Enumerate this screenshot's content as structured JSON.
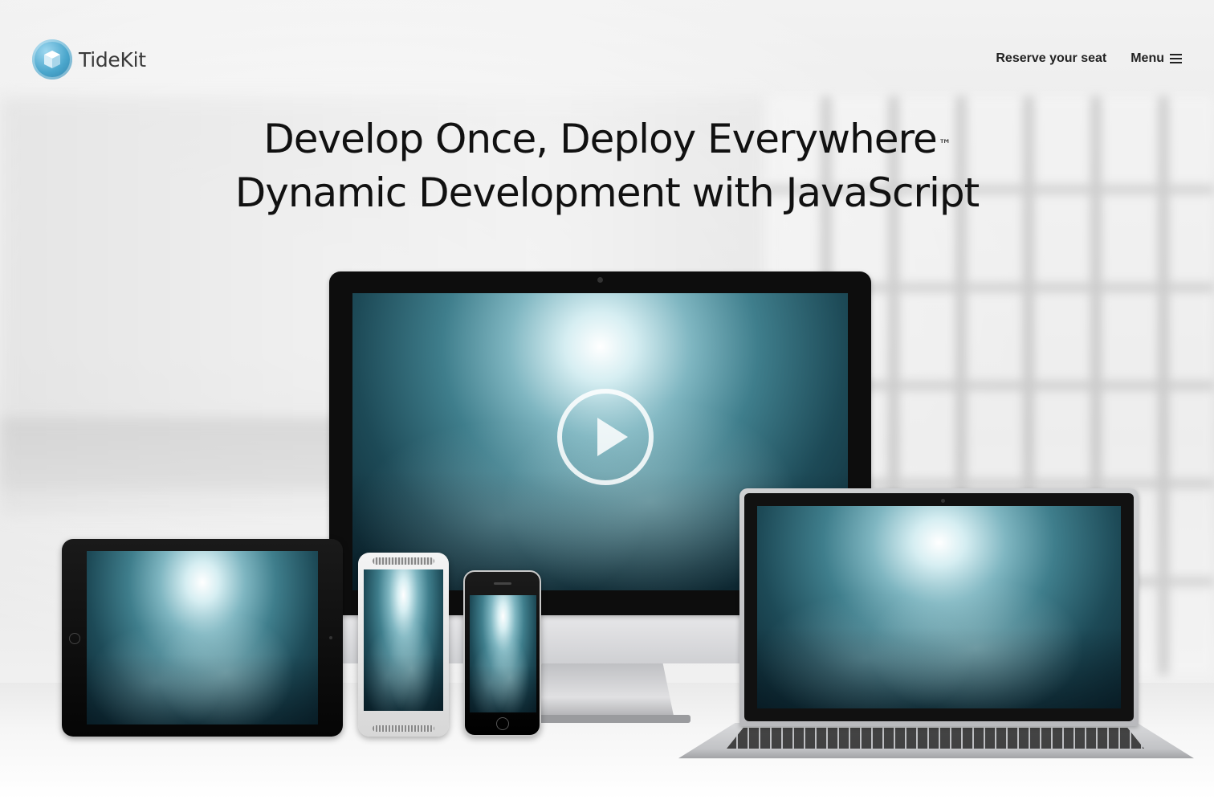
{
  "header": {
    "logo_text": "TideKit",
    "nav": {
      "reserve_label": "Reserve your seat",
      "menu_label": "Menu"
    }
  },
  "hero": {
    "headline_line1": "Develop Once, Deploy Everywhere",
    "headline_trademark": "™",
    "headline_line2": "Dynamic Development with JavaScript"
  },
  "devices": {
    "names": [
      "desktop-monitor",
      "tablet",
      "android-phone",
      "iphone",
      "laptop"
    ],
    "screen_content": "underwater-scene",
    "play_icon": "play-circle-icon"
  },
  "colors": {
    "logo_accent": "#4aa6cc",
    "text": "#111111",
    "background": "#eeeeee"
  }
}
